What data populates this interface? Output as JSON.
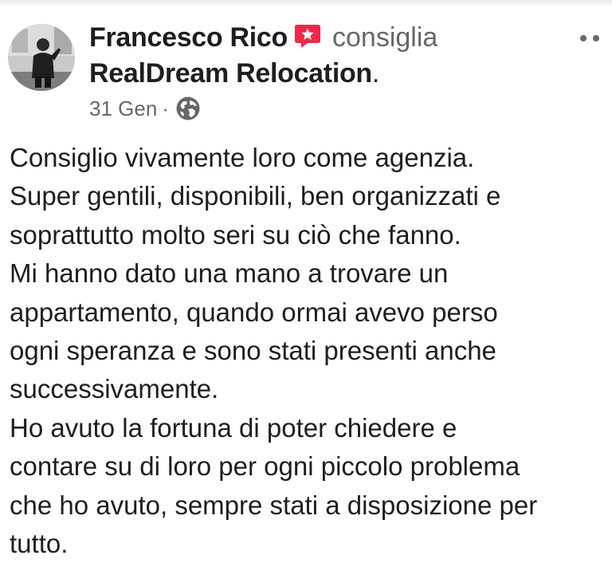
{
  "post": {
    "author": "Francesco Rico",
    "action": "consiglia",
    "page_name": "RealDream Relocation",
    "page_suffix": ".",
    "date": "31 Gen",
    "separator": "·",
    "privacy_icon": "globe-icon",
    "recommend_icon": "recommendation-badge-icon",
    "more_icon": "more-options-icon",
    "accent_color": "#f02849",
    "body_lines": [
      "Consiglio vivamente loro come agenzia.",
      "Super gentili, disponibili, ben organizzati e",
      "soprattutto molto seri su ciò che fanno.",
      "Mi hanno dato una mano a trovare un",
      "appartamento, quando ormai avevo perso",
      "ogni speranza e sono stati presenti anche",
      "successivamente.",
      "Ho avuto la fortuna di poter chiedere e",
      "contare su di loro per ogni piccolo problema",
      "che ho avuto, sempre stati a disposizione per",
      "tutto."
    ]
  }
}
